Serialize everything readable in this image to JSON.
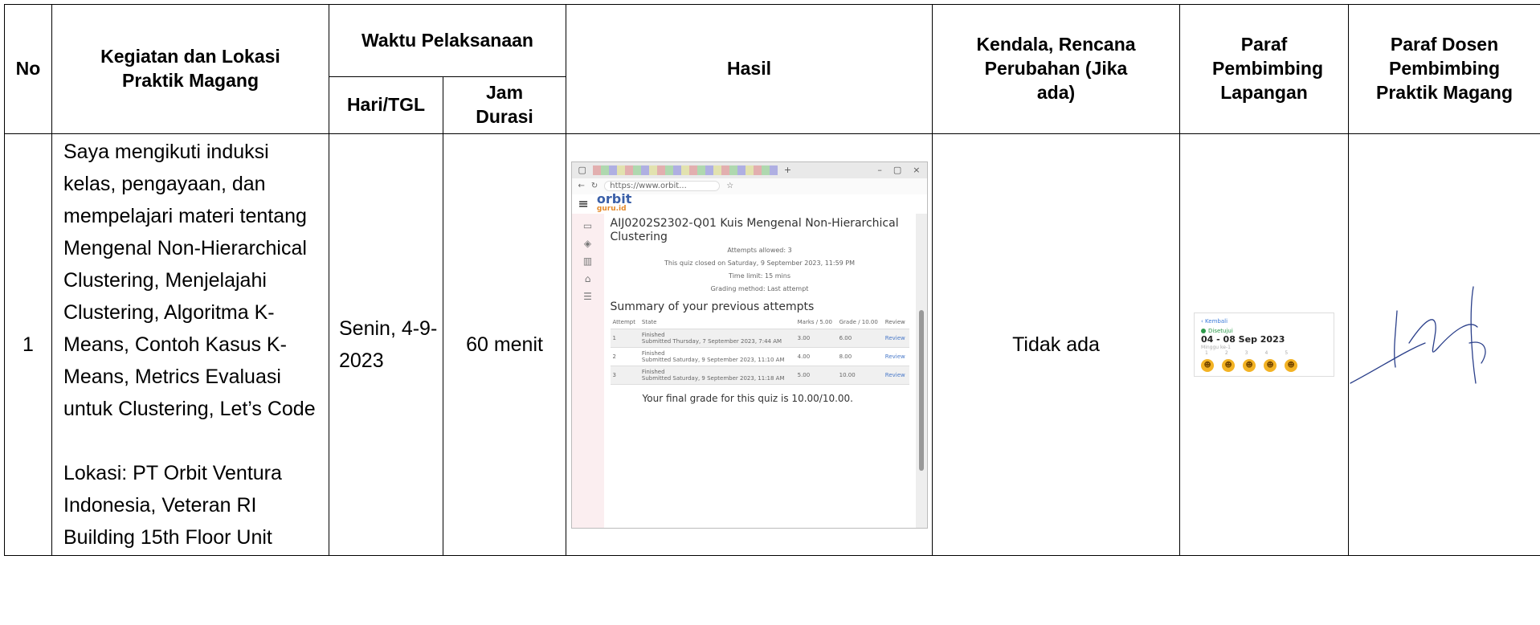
{
  "header": {
    "no": "No",
    "kegiatan": "Kegiatan dan Lokasi Praktik Magang",
    "waktu": "Waktu Pelaksanaan",
    "hari": "Hari/TGL",
    "jam": "Jam Durasi",
    "hasil": "Hasil",
    "kendala": "Kendala, Rencana Perubahan (Jika ada)",
    "paraf_lapangan": "Paraf Pembimbing Lapangan",
    "paraf_dosen": "Paraf Dosen Pembimbing Praktik Magang"
  },
  "row": {
    "no": "1",
    "kegiatan": "Saya mengikuti induksi kelas, pengayaan, dan mempelajari materi tentang Mengenal Non-Hierarchical Clustering, Menjelajahi Clustering, Algoritma K-Means, Contoh Kasus K-Means, Metrics Evaluasi untuk Clustering, Let’s Code",
    "lokasi": "Lokasi: PT Orbit Ventura Indonesia, Veteran RI Building 15th Floor Unit",
    "hari": "Senin, 4-9-2023",
    "durasi": "60 menit",
    "kendala": "Tidak ada"
  },
  "screenshot": {
    "url": "https://www.orbit...",
    "logo_main": "orbit",
    "logo_sub": "guru.id",
    "title": "AIJ0202S2302-Q01 Kuis Mengenal Non-Hierarchical Clustering",
    "attempts_allowed": "Attempts allowed: 3",
    "closed": "This quiz closed on Saturday, 9 September 2023, 11:59 PM",
    "time_limit": "Time limit: 15 mins",
    "grading": "Grading method: Last attempt",
    "summary": "Summary of your previous attempts",
    "columns": [
      "Attempt",
      "State",
      "Marks / 5.00",
      "Grade / 10.00",
      "Review"
    ],
    "attempts": [
      {
        "num": "1",
        "state": "Finished",
        "submitted": "Submitted Thursday, 7 September 2023, 7:44 AM",
        "marks": "3.00",
        "grade": "6.00",
        "review": "Review"
      },
      {
        "num": "2",
        "state": "Finished",
        "submitted": "Submitted Saturday, 9 September 2023, 11:10 AM",
        "marks": "4.00",
        "grade": "8.00",
        "review": "Review"
      },
      {
        "num": "3",
        "state": "Finished",
        "submitted": "Submitted Saturday, 9 September 2023, 11:18 AM",
        "marks": "5.00",
        "grade": "10.00",
        "review": "Review"
      }
    ],
    "final": "Your final grade for this quiz is 10.00/10.00."
  },
  "paraf_card": {
    "back": "‹ Kembali",
    "status": "Disetujui",
    "date": "04 - 08 Sep 2023",
    "sub": "Minggu ke-1",
    "days": [
      "1",
      "2",
      "3",
      "4",
      "5"
    ]
  }
}
